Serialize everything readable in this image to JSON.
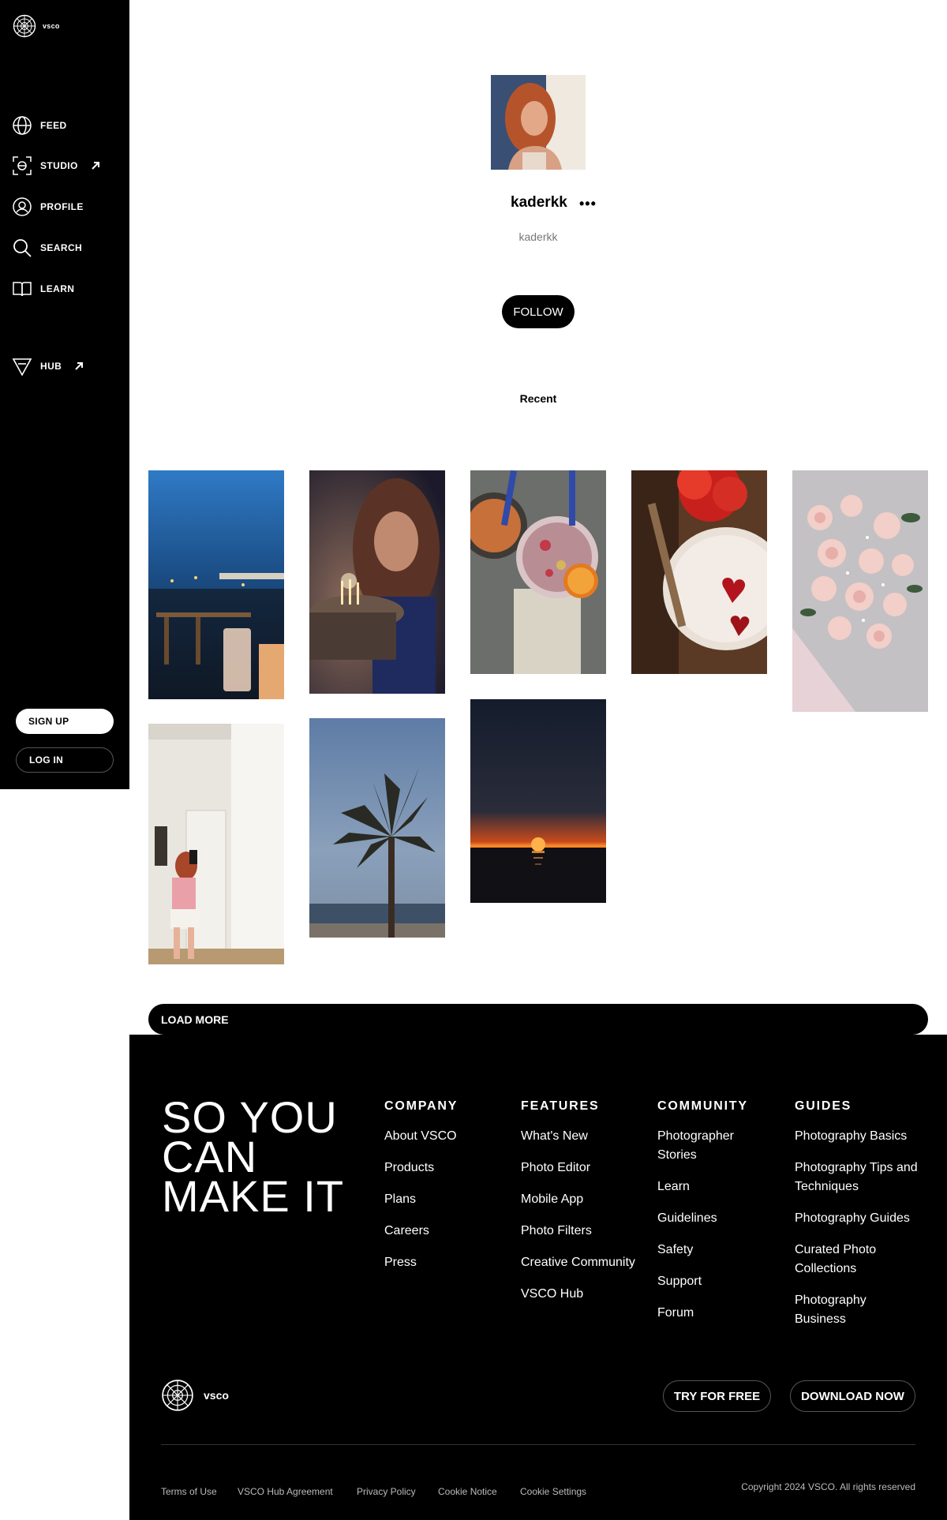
{
  "app": {
    "wordmark": "vsco"
  },
  "sidebar": {
    "nav": [
      {
        "label": "FEED",
        "icon": "globe-icon"
      },
      {
        "label": "STUDIO",
        "icon": "studio-icon",
        "external": true
      },
      {
        "label": "PROFILE",
        "icon": "profile-icon"
      },
      {
        "label": "SEARCH",
        "icon": "search-icon"
      },
      {
        "label": "LEARN",
        "icon": "book-icon"
      },
      {
        "label": "HUB",
        "icon": "hub-triangle-icon",
        "external": true
      }
    ],
    "signup_label": "SIGN UP",
    "login_label": "LOG IN"
  },
  "profile": {
    "username": "kaderkk",
    "handle": "kaderkk",
    "more_label": "•••",
    "follow_label": "FOLLOW",
    "tab_label": "Recent"
  },
  "grid": {
    "load_more_label": "LOAD MORE"
  },
  "footer": {
    "tagline": "SO  YOU\nCAN\nMAKE IT",
    "columns": [
      {
        "heading": "COMPANY",
        "links": [
          "About VSCO",
          "Products",
          "Plans",
          "Careers",
          "Press"
        ]
      },
      {
        "heading": "FEATURES",
        "links": [
          "What's New",
          "Photo Editor",
          "Mobile App",
          "Photo Filters",
          "Creative Community",
          "VSCO Hub"
        ]
      },
      {
        "heading": "COMMUNITY",
        "links": [
          "Photographer Stories",
          "Learn",
          "Guidelines",
          "Safety",
          "Support",
          "Forum"
        ]
      },
      {
        "heading": "GUIDES",
        "links": [
          "Photography Basics",
          "Photography Tips and Techniques",
          "Photography Guides",
          "Curated Photo Collections",
          "Photography Business"
        ]
      }
    ],
    "wordmark": "vsco",
    "try_label": "TRY FOR FREE",
    "download_label": "DOWNLOAD NOW",
    "legal_links": [
      "Terms of Use",
      "VSCO Hub Agreement",
      "Privacy Policy",
      "Cookie Notice",
      "Cookie Settings"
    ],
    "copyright": "Copyright 2024 VSCO. All rights reserved"
  }
}
